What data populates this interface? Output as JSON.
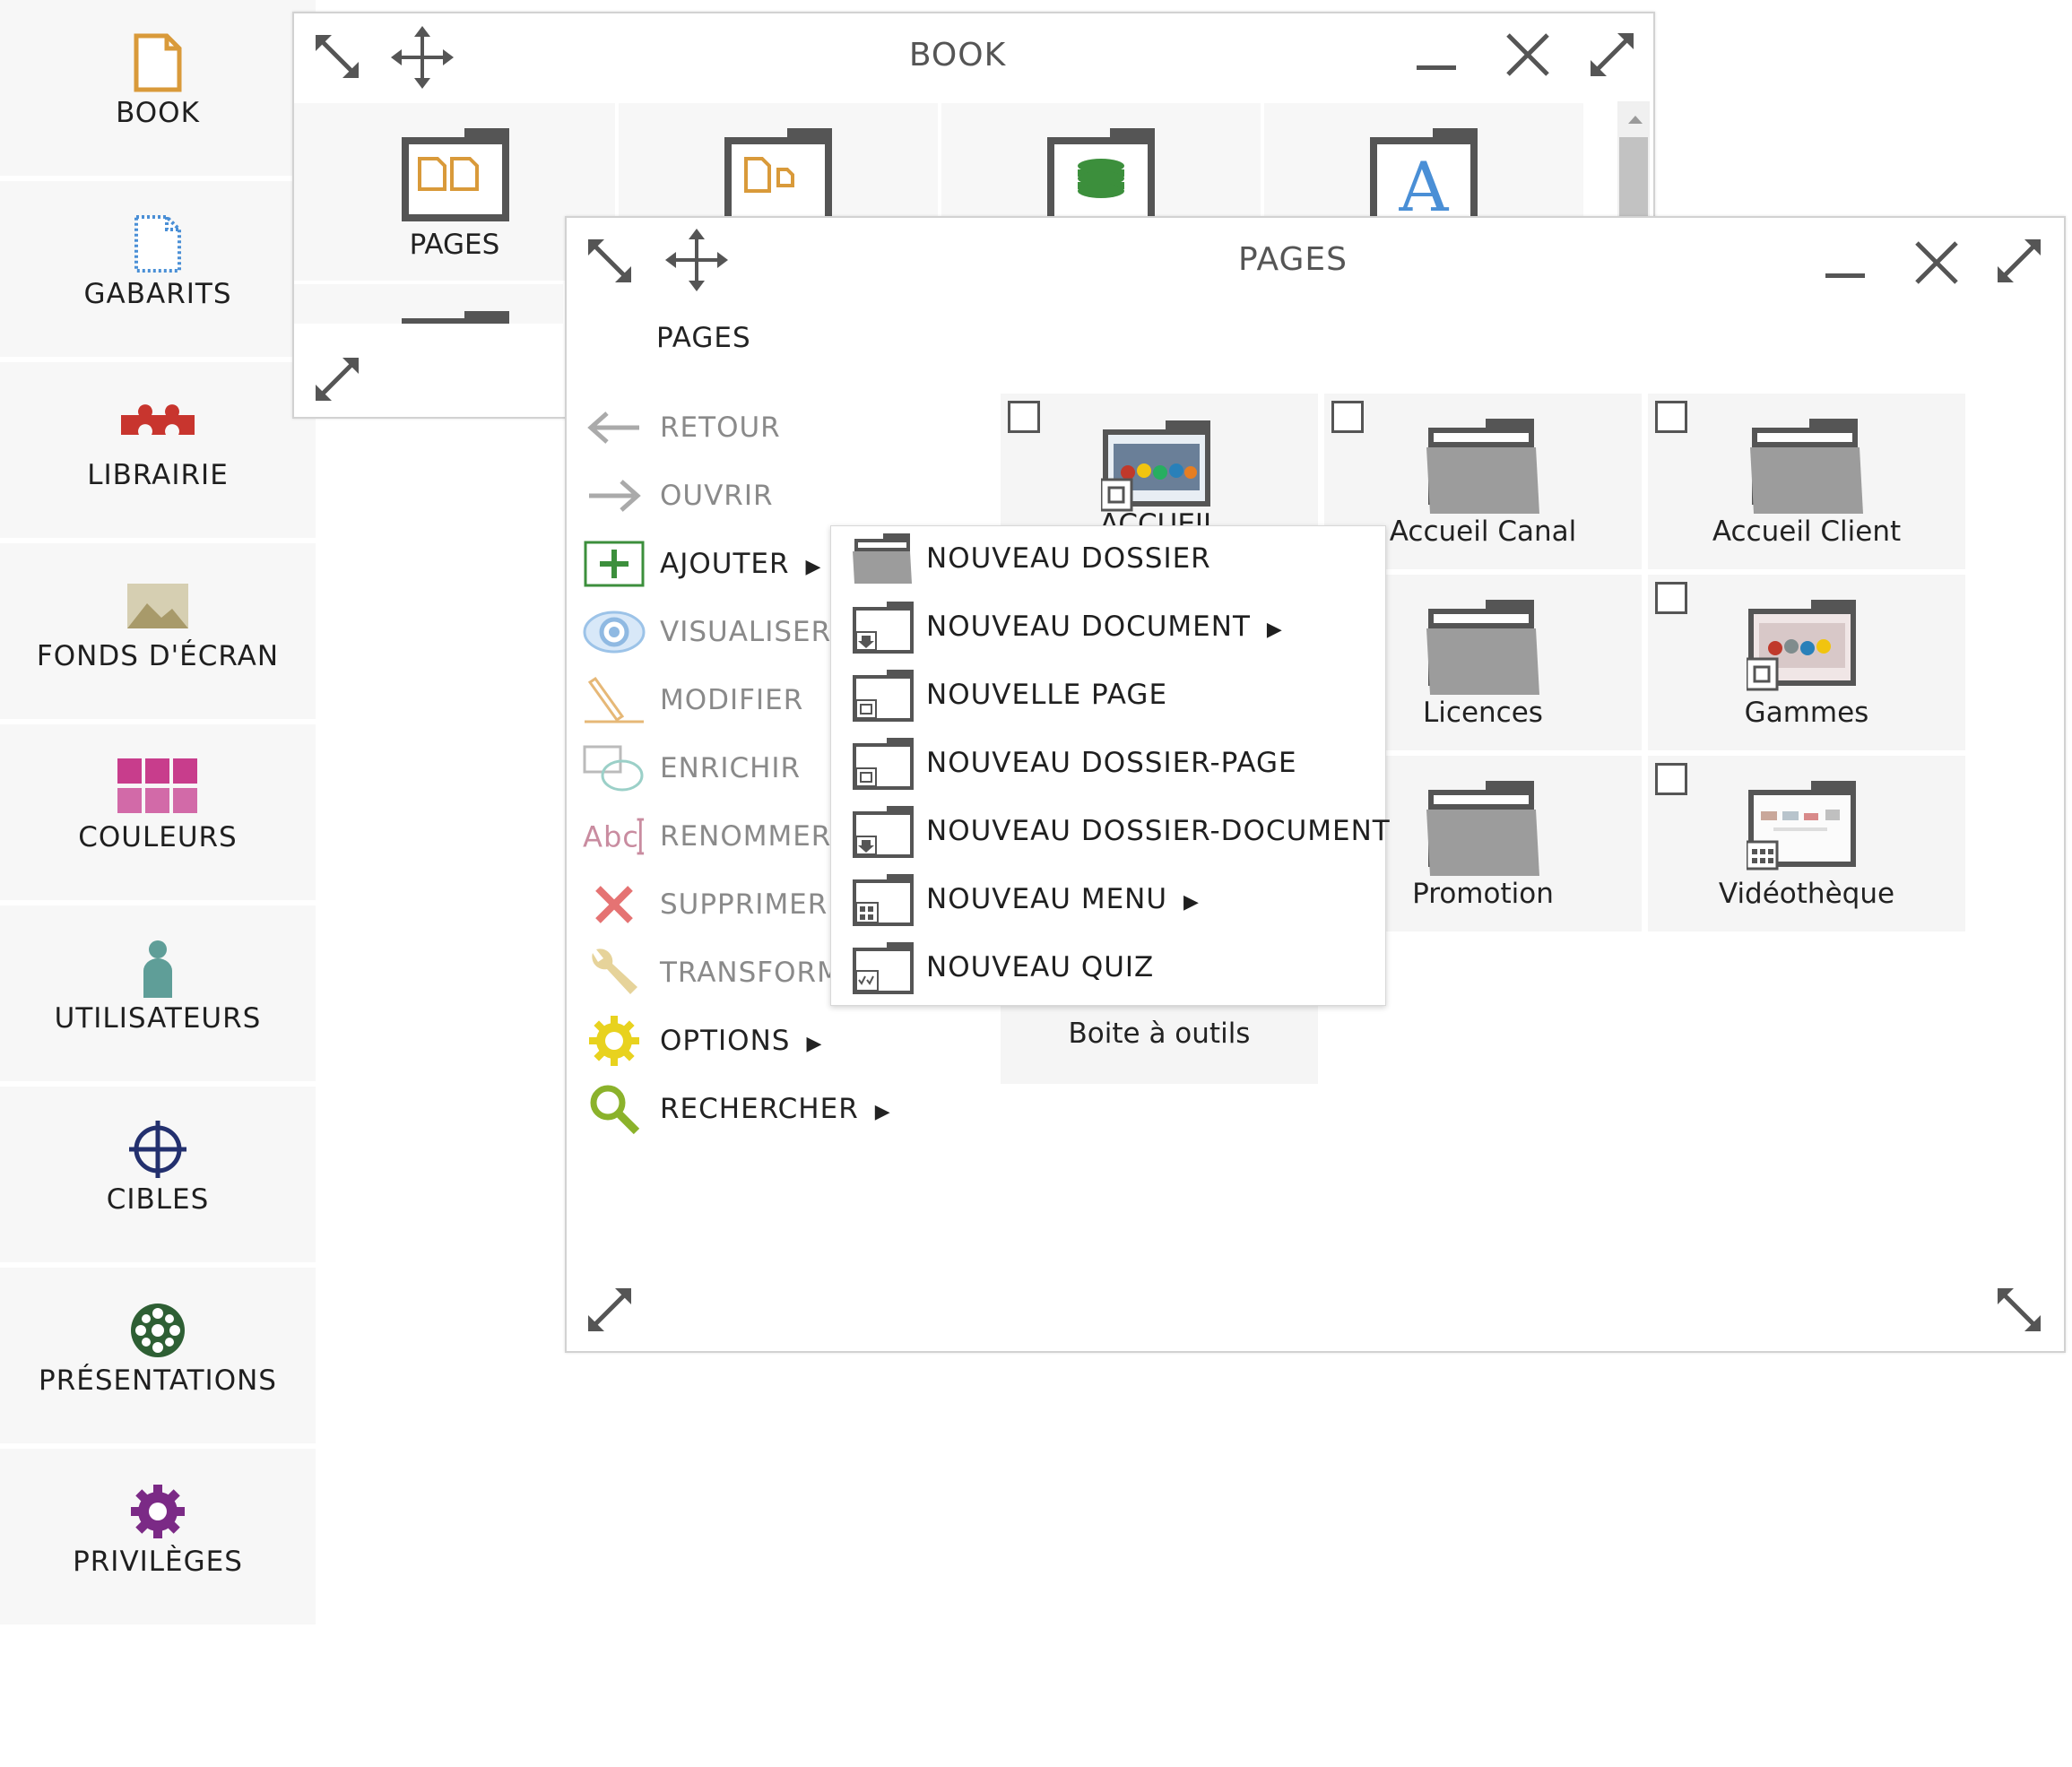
{
  "sidebar": {
    "items": [
      {
        "label": "BOOK",
        "icon": "document-icon"
      },
      {
        "label": "GABARITS",
        "icon": "template-icon"
      },
      {
        "label": "LIBRAIRIE",
        "icon": "puzzle-icon"
      },
      {
        "label": "FONDS D'ÉCRAN",
        "icon": "landscape-icon"
      },
      {
        "label": "COULEURS",
        "icon": "palette-icon"
      },
      {
        "label": "UTILISATEURS",
        "icon": "user-icon"
      },
      {
        "label": "CIBLES",
        "icon": "crosshair-icon"
      },
      {
        "label": "PRÉSENTATIONS",
        "icon": "wheel-icon"
      },
      {
        "label": "PRIVILÈGES",
        "icon": "gear-icon"
      }
    ]
  },
  "book_window": {
    "title": "BOOK",
    "tiles": [
      {
        "label": "PAGES"
      }
    ]
  },
  "pages_window": {
    "title": "PAGES",
    "breadcrumb": "PAGES",
    "menu": [
      {
        "label": "RETOUR",
        "state": "disabled"
      },
      {
        "label": "OUVRIR",
        "state": "disabled"
      },
      {
        "label": "AJOUTER",
        "state": "active",
        "has_submenu": true
      },
      {
        "label": "VISUALISER",
        "state": "disabled"
      },
      {
        "label": "MODIFIER",
        "state": "disabled"
      },
      {
        "label": "ENRICHIR",
        "state": "disabled"
      },
      {
        "label": "RENOMMER",
        "state": "disabled"
      },
      {
        "label": "SUPPRIMER",
        "state": "disabled"
      },
      {
        "label": "TRANSFORM",
        "state": "disabled"
      },
      {
        "label": "OPTIONS",
        "state": "active",
        "has_submenu": true
      },
      {
        "label": "RECHERCHER",
        "state": "active",
        "has_submenu": true
      }
    ],
    "items": [
      {
        "label": "ACCUEIL",
        "type": "page-folder"
      },
      {
        "label": "Accueil Canal",
        "type": "folder"
      },
      {
        "label": "Accueil Client",
        "type": "folder"
      },
      {
        "label": "Licences",
        "type": "folder"
      },
      {
        "label": "Gammes",
        "type": "page-folder"
      },
      {
        "label": "Promotion",
        "type": "folder"
      },
      {
        "label": "Vidéothèque",
        "type": "menu-folder"
      },
      {
        "label": "Boite à outils",
        "type": "folder"
      }
    ],
    "submenu": [
      {
        "label": "NOUVEAU DOSSIER"
      },
      {
        "label": "NOUVEAU DOCUMENT",
        "arrow": "▶"
      },
      {
        "label": "NOUVELLE PAGE"
      },
      {
        "label": "NOUVEAU DOSSIER-PAGE"
      },
      {
        "label": "NOUVEAU DOSSIER-DOCUMENT"
      },
      {
        "label": "NOUVEAU MENU",
        "arrow": "▶"
      },
      {
        "label": "NOUVEAU QUIZ"
      }
    ]
  },
  "symbols": {
    "arrow": "▶"
  },
  "colors": {
    "book_orange": "#d99a3a",
    "template_blue": "#4a8fd6",
    "puzzle_red": "#c8352e",
    "users_teal": "#5f9e98",
    "cibles_navy": "#23306e",
    "presentations_green": "#2e5f34",
    "privileges_purple": "#7b2a86",
    "add_green": "#3c8f3c",
    "options_yellow": "#e8d21e",
    "search_green": "#8bb22b",
    "delete_red": "#e57373"
  }
}
